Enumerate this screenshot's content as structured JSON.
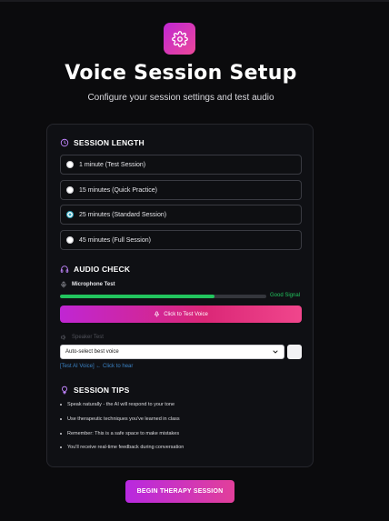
{
  "header": {
    "title": "Voice Session Setup",
    "subtitle": "Configure your session settings and test audio",
    "icon": "gear-icon"
  },
  "session_length": {
    "title": "SESSION LENGTH",
    "icon": "clock-icon",
    "options": [
      {
        "label": "1 minute (Test Session)",
        "selected": false
      },
      {
        "label": "15 minutes (Quick Practice)",
        "selected": false
      },
      {
        "label": "25 minutes (Standard Session)",
        "selected": true
      },
      {
        "label": "45 minutes (Full Session)",
        "selected": false
      }
    ]
  },
  "audio_check": {
    "title": "AUDIO CHECK",
    "icon": "headphones-icon",
    "microphone_label": "Microphone Test",
    "signal_level": 0.75,
    "signal_status": "Good Signal",
    "test_voice_button": "Click to Test Voice",
    "speaker_label": "Speaker Test",
    "voice_select_value": "Auto-select best voice",
    "test_ai_voice_link": "[Test AI Voice] ← Click to hear"
  },
  "session_tips": {
    "title": "SESSION TIPS",
    "icon": "lightbulb-icon",
    "tips": [
      "Speak naturally - the AI will respond to your tone",
      "Use therapeutic techniques you've learned in class",
      "Remember: This is a safe space to make mistakes",
      "You'll receive real-time feedback during conversation"
    ]
  },
  "begin_button": "BEGIN THERAPY SESSION",
  "colors": {
    "background": "#0b0b0d",
    "accent_start": "#c026d3",
    "accent_end": "#ec4899",
    "signal_green": "#22c55e",
    "link_blue": "#3b82c4"
  }
}
